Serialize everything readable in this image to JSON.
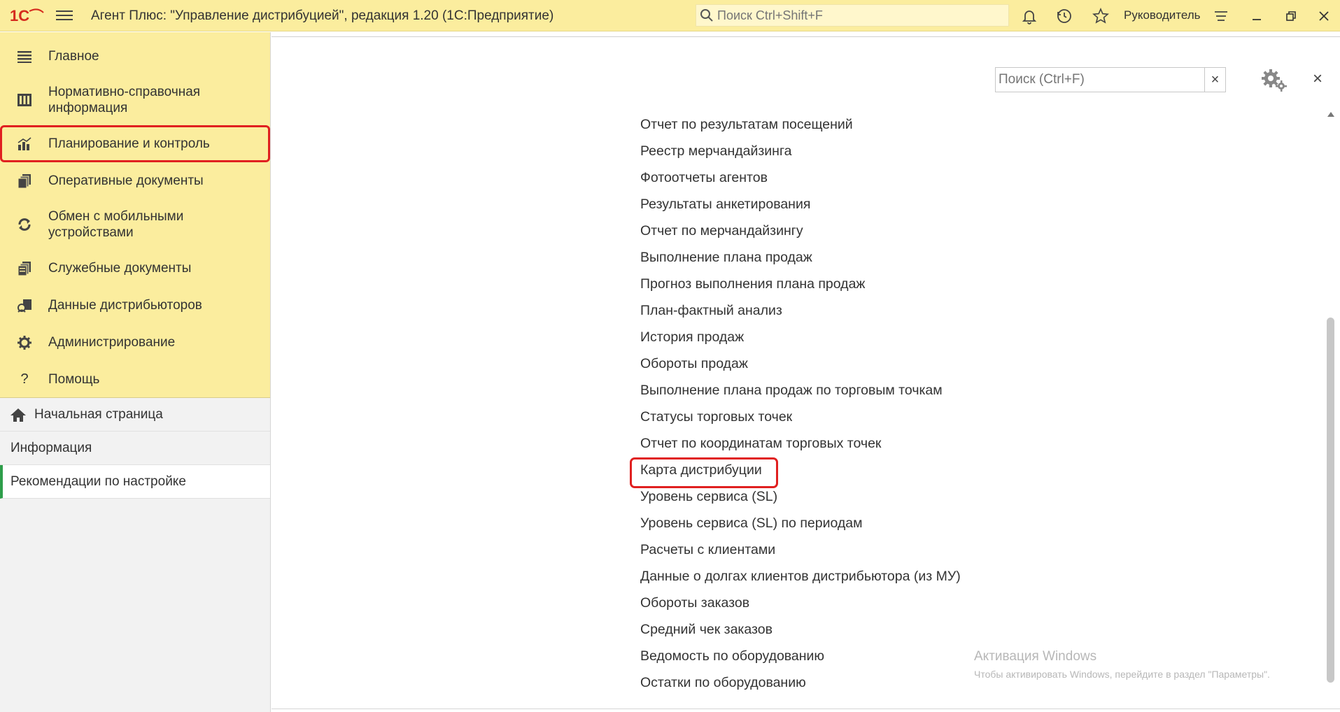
{
  "titlebar": {
    "app_title": "Агент Плюс: \"Управление дистрибуцией\", редакция 1.20  (1С:Предприятие)",
    "search_placeholder": "Поиск Ctrl+Shift+F",
    "user": "Руководитель",
    "logo_text": "1С"
  },
  "sidebar": {
    "sections": [
      {
        "label": "Главное",
        "icon": "list-icon"
      },
      {
        "label": "Нормативно-справочная информация",
        "icon": "catalog-icon"
      },
      {
        "label": "Планирование и контроль",
        "icon": "chart-icon"
      },
      {
        "label": "Оперативные документы",
        "icon": "documents-icon"
      },
      {
        "label": "Обмен с мобильными устройствами",
        "icon": "sync-icon"
      },
      {
        "label": "Служебные документы",
        "icon": "service-docs-icon"
      },
      {
        "label": "Данные дистрибьюторов",
        "icon": "distributors-icon"
      },
      {
        "label": "Администрирование",
        "icon": "gear-icon"
      },
      {
        "label": "Помощь",
        "icon": "help-icon"
      }
    ],
    "nav": [
      {
        "label": "Начальная страница",
        "icon": "home-icon"
      },
      {
        "label": "Информация"
      },
      {
        "label": "Рекомендации по настройке"
      }
    ]
  },
  "panel": {
    "search_placeholder": "Поиск (Ctrl+F)",
    "clear_label": "×",
    "close_label": "×",
    "reports": [
      "Отчет по результатам посещений",
      "Реестр мерчандайзинга",
      "Фотоотчеты агентов",
      "Результаты анкетирования",
      "Отчет по  мерчандайзингу",
      "Выполнение плана продаж",
      "Прогноз выполнения плана продаж",
      "План-фактный анализ",
      "История продаж",
      "Обороты продаж",
      "Выполнение плана продаж по торговым точкам",
      "Статусы торговых точек",
      "Отчет по координатам торговых точек",
      "Карта дистрибуции",
      "Уровень сервиса (SL)",
      "Уровень сервиса (SL) по периодам",
      "Расчеты с клиентами",
      "Данные о долгах клиентов дистрибьютора (из МУ)",
      "Обороты заказов",
      "Средний чек заказов",
      "Ведомость по оборудованию",
      "Остатки по оборудованию"
    ]
  },
  "watermark": {
    "title": "Активация Windows",
    "subtitle": "Чтобы активировать Windows, перейдите в раздел \"Параметры\"."
  },
  "colors": {
    "accent_yellow": "#fbed9e",
    "highlight_red": "#e02020",
    "active_green": "#2e9e4a",
    "logo_red": "#d52b1e"
  }
}
